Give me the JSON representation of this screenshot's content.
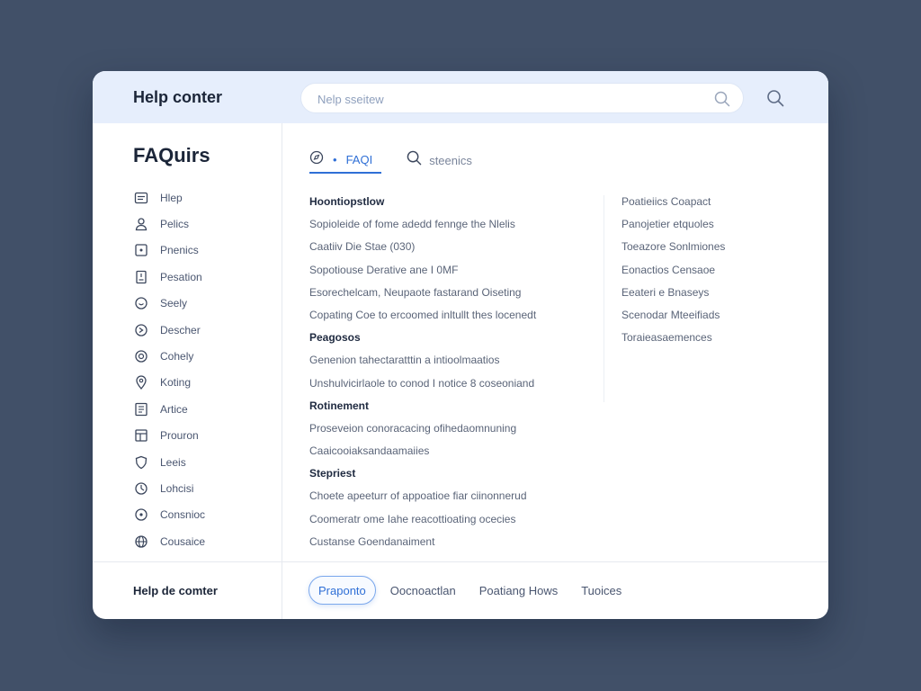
{
  "header": {
    "title": "Help conter",
    "search_placeholder": "Nelp sseitew"
  },
  "sidebar": {
    "title": "FAQuirs",
    "items": [
      {
        "label": "Hlep",
        "icon": "message-icon"
      },
      {
        "label": "Pelics",
        "icon": "user-icon"
      },
      {
        "label": "Pnenics",
        "icon": "square-dot-icon"
      },
      {
        "label": "Pesation",
        "icon": "document-icon"
      },
      {
        "label": "Seely",
        "icon": "chat-bubble-icon"
      },
      {
        "label": "Descher",
        "icon": "refresh-icon"
      },
      {
        "label": "Cohely",
        "icon": "smile-icon"
      },
      {
        "label": "Koting",
        "icon": "location-pin-icon"
      },
      {
        "label": "Artice",
        "icon": "article-icon"
      },
      {
        "label": "Prouron",
        "icon": "image-icon"
      },
      {
        "label": "Leeis",
        "icon": "shield-icon"
      },
      {
        "label": "Lohcisi",
        "icon": "target-icon"
      },
      {
        "label": "Consnioc",
        "icon": "circle-dot-icon"
      },
      {
        "label": "Cousaice",
        "icon": "globe-icon"
      }
    ]
  },
  "tabs": {
    "dot": "•",
    "faq_label": "FAQI",
    "search_label": "steenics"
  },
  "main": {
    "sections": [
      {
        "heading": "Hoontiopstlow",
        "items": [
          "Sopioleide of fome adedd fennge the Nlelis",
          "Caatiiv Die Stae (030)",
          "Sopotiouse Derative ane I 0MF",
          "Esorechelcam, Neupaote fastarand Oiseting",
          "Copating Coe to ercoomed inltullt thes locenedt"
        ]
      },
      {
        "heading": "Peagosos",
        "items": [
          "Genenion tahectaratttin a intioolmaatios",
          "Unshulvicirlaole to conod I notice 8 coseoniand"
        ]
      },
      {
        "heading": "Rotinement",
        "items": [
          "Proseveion conoracacing ofihedaomnuning",
          "Caaicooiaksandaamaiies"
        ]
      },
      {
        "heading": "Stepriest",
        "items": [
          "Choete apeeturr of appoatioe fiar ciinonnerud",
          "Coomeratr ome Iahe reacottioating ocecies",
          "Custanse Goendanaiment"
        ]
      }
    ],
    "right_links": [
      "Poatieiics Coapact",
      "Panojetier etquoles",
      "Toeazore Sonlmiones",
      "Eonactios Censaoe",
      "Eeateri e Bnaseys",
      "Scenodar Mteeifiads",
      "Toraieasaemences"
    ]
  },
  "footer": {
    "title": "Help de comter",
    "links": [
      "Praponto",
      "Oocnoactlan",
      "Poatiang Hows",
      "Tuoices"
    ]
  },
  "colors": {
    "accent": "#2f6fd6",
    "header_bg": "#e6eefc",
    "page_bg": "#415068"
  }
}
